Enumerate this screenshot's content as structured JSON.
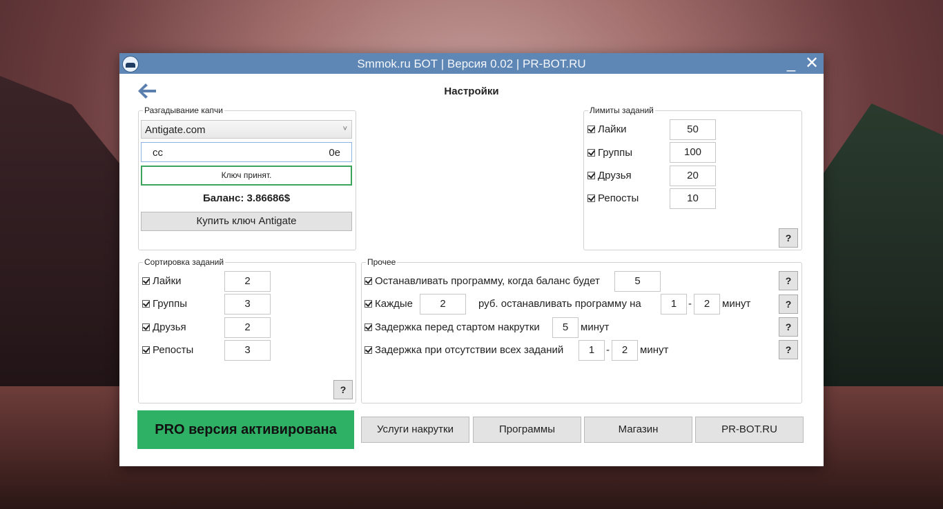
{
  "window": {
    "title": "Smmok.ru БОТ | Версия 0.02 | PR-BOT.RU",
    "min_label": "_",
    "close_label": "✕"
  },
  "page": {
    "title": "Настройки"
  },
  "captcha": {
    "legend": "Разгадывание капчи",
    "service": "Antigate.com",
    "key_prefix": "cc",
    "key_suffix": "0e",
    "status": "Ключ принят.",
    "balance": "Баланс: 3.86686$",
    "buy_label": "Купить ключ Antigate"
  },
  "limits": {
    "legend": "Лимиты заданий",
    "items": [
      {
        "label": "Лайки",
        "value": "50"
      },
      {
        "label": "Группы",
        "value": "100"
      },
      {
        "label": "Друзья",
        "value": "20"
      },
      {
        "label": "Репосты",
        "value": "10"
      }
    ],
    "help": "?"
  },
  "sorting": {
    "legend": "Сортировка заданий",
    "items": [
      {
        "label": "Лайки",
        "value": "2"
      },
      {
        "label": "Группы",
        "value": "3"
      },
      {
        "label": "Друзья",
        "value": "2"
      },
      {
        "label": "Репосты",
        "value": "3"
      }
    ],
    "help": "?"
  },
  "misc": {
    "legend": "Прочее",
    "stop_balance": {
      "label": "Останавливать программу, когда баланс будет",
      "value": "5"
    },
    "every": {
      "label": "Каждые",
      "value": "2",
      "middle": "руб. останавливать программу на",
      "from": "1",
      "dash": "-",
      "to": "2",
      "unit": "минут"
    },
    "start_delay": {
      "label": "Задержка перед стартом накрутки",
      "value": "5",
      "unit": "минут"
    },
    "idle_delay": {
      "label": "Задержка при отсутствии всех заданий",
      "from": "1",
      "dash": "-",
      "to": "2",
      "unit": "минут"
    },
    "help": "?"
  },
  "footer": {
    "pro": "PRO версия активирована",
    "buttons": [
      "Услуги накрутки",
      "Программы",
      "Магазин",
      "PR-BOT.RU"
    ]
  }
}
